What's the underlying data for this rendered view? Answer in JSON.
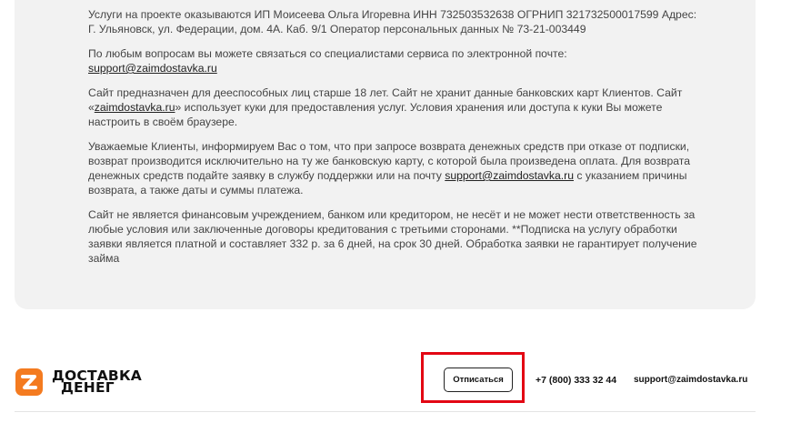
{
  "info": {
    "p1": "Услуги на проекте оказываются ИП Моисеева Ольга Игоревна ИНН 732503532638 ОГРНИП 321732500017599 Адрес: Г. Ульяновск, ул. Федерации, дом. 4А. Каб. 9/1 Оператор персональных данных № 73-21-003449",
    "p2_text": "По любым вопросам вы можете связаться со специалистами сервиса по электронной почте:",
    "p2_email": "support@zaimdostavka.ru",
    "p3_before": "Сайт предназначен для дееспособных лиц старше 18 лет. Сайт не хранит данные банковских карт Клиентов. Сайт «",
    "p3_link": "zaimdostavka.ru",
    "p3_after": "» использует куки для предоставления услуг. Условия хранения или доступа к куки Вы можете настроить в своём браузере.",
    "p4_before": "Уважаемые Клиенты, информируем Вас о том, что при запросе возврата денежных средств при отказе от подписки, возврат производится исключительно на ту же банковскую карту, с которой была произведена оплата. Для возврата денежных средств подайте заявку в службу поддержки или на почту ",
    "p4_email": "support@zaimdostavka.ru",
    "p4_after": " с указанием причины возврата, а также даты и суммы платежа.",
    "p5": "Сайт не является финансовым учреждением, банком или кредитором, не несёт и не может нести ответственность за любые условия или заключенные договоры кредитования с третьими сторонами. **Подписка на услугу обработки заявки является платной и составляет 332 р. за 6 дней, на срок 30 дней. Обработка заявки не гарантирует получение займа"
  },
  "footer": {
    "logo_line1": "ДОСТАВКА",
    "logo_line2": "ДЕНЕГ",
    "unsubscribe_label": "Отписаться",
    "phone": "+7 (800) 333 32 44",
    "email": "support@zaimdostavka.ru"
  },
  "colors": {
    "logo_orange": "#f47b20",
    "highlight_red": "#e30613",
    "card_bg": "#f2f2f2"
  },
  "icons": {
    "logo": "logo-z-mark-icon"
  }
}
